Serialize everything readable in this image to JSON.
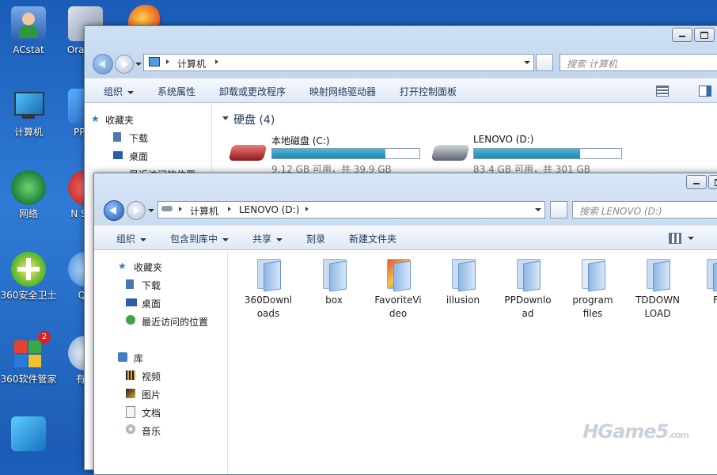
{
  "desktop": {
    "icons": [
      {
        "label": "ACstat",
        "icon": "user-icon"
      },
      {
        "label": "Ora Virt",
        "icon": "virtualbox-icon"
      },
      {
        "label": "",
        "icon": "firefox-icon"
      },
      {
        "label": "计算机",
        "icon": "computer-icon"
      },
      {
        "label": "PPTV",
        "icon": "pptv-icon"
      },
      {
        "label": "网络",
        "icon": "network-icon"
      },
      {
        "label": "N Star",
        "icon": "app-icon"
      },
      {
        "label": "360安全卫士",
        "icon": "360-safe-icon"
      },
      {
        "label": "QQ",
        "icon": "qq-icon"
      },
      {
        "label": "360软件管家",
        "icon": "360-software-icon"
      },
      {
        "label": "有道",
        "icon": "youdao-icon"
      },
      {
        "label": "",
        "icon": "app-icon"
      }
    ],
    "badge": "2"
  },
  "back_window": {
    "address": [
      "计算机"
    ],
    "search_placeholder": "搜索 计算机",
    "toolbar": [
      "组织",
      "系统属性",
      "卸载或更改程序",
      "映射网络驱动器",
      "打开控制面板"
    ],
    "nav": [
      "收藏夹",
      "下载",
      "桌面",
      "最近访问的位置"
    ],
    "group_title": "硬盘 (4)",
    "drives": [
      {
        "name": "本地磁盘 (C:)",
        "free": "9.12 GB 可用，共 39.9 GB",
        "used_fraction": 0.77
      },
      {
        "name": "LENOVO (D:)",
        "free": "83.4 GB 可用，共 301 GB",
        "used_fraction": 0.72
      }
    ]
  },
  "front_window": {
    "address": [
      "计算机",
      "LENOVO (D:)"
    ],
    "search_placeholder": "搜索 LENOVO (D:)",
    "toolbar": [
      "组织",
      "包含到库中",
      "共享",
      "刻录",
      "新建文件夹"
    ],
    "nav_favorites": {
      "title": "收藏夹",
      "items": [
        "下载",
        "桌面",
        "最近访问的位置"
      ]
    },
    "nav_library": {
      "title": "库",
      "items": [
        "视频",
        "图片",
        "文档",
        "音乐"
      ]
    },
    "folders": [
      {
        "line1": "360Downl",
        "line2": "oads"
      },
      {
        "line1": "box",
        "line2": ""
      },
      {
        "line1": "FavoriteVi",
        "line2": "deo"
      },
      {
        "line1": "illusion",
        "line2": ""
      },
      {
        "line1": "PPDownlo",
        "line2": "ad"
      },
      {
        "line1": "program",
        "line2": "files"
      },
      {
        "line1": "TDDOWN",
        "line2": "LOAD"
      },
      {
        "line1": "F",
        "line2": ""
      }
    ]
  },
  "watermark": {
    "text": "HGame5",
    "suffix": ".com"
  }
}
